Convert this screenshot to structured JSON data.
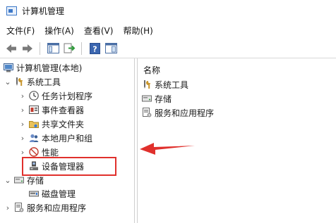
{
  "window": {
    "title": "计算机管理"
  },
  "menu": {
    "items": [
      "文件(F)",
      "操作(A)",
      "查看(V)",
      "帮助(H)"
    ]
  },
  "toolbar": {
    "buttons": [
      "back-icon",
      "forward-icon",
      "show-hide-console-tree-icon",
      "export-list-icon",
      "help-icon",
      "properties-view-icon"
    ]
  },
  "tree": {
    "root": "计算机管理(本地)",
    "system_tools": "系统工具",
    "task_scheduler": "任务计划程序",
    "event_viewer": "事件查看器",
    "shared_folders": "共享文件夹",
    "local_users_groups": "本地用户和组",
    "performance": "性能",
    "device_manager": "设备管理器",
    "storage": "存储",
    "disk_management": "磁盘管理",
    "services_apps": "服务和应用程序"
  },
  "content": {
    "column_header": "名称",
    "items": [
      "系统工具",
      "存储",
      "服务和应用程序"
    ]
  },
  "colors": {
    "highlight": "#e0302c",
    "accent": "#3c78c8"
  }
}
